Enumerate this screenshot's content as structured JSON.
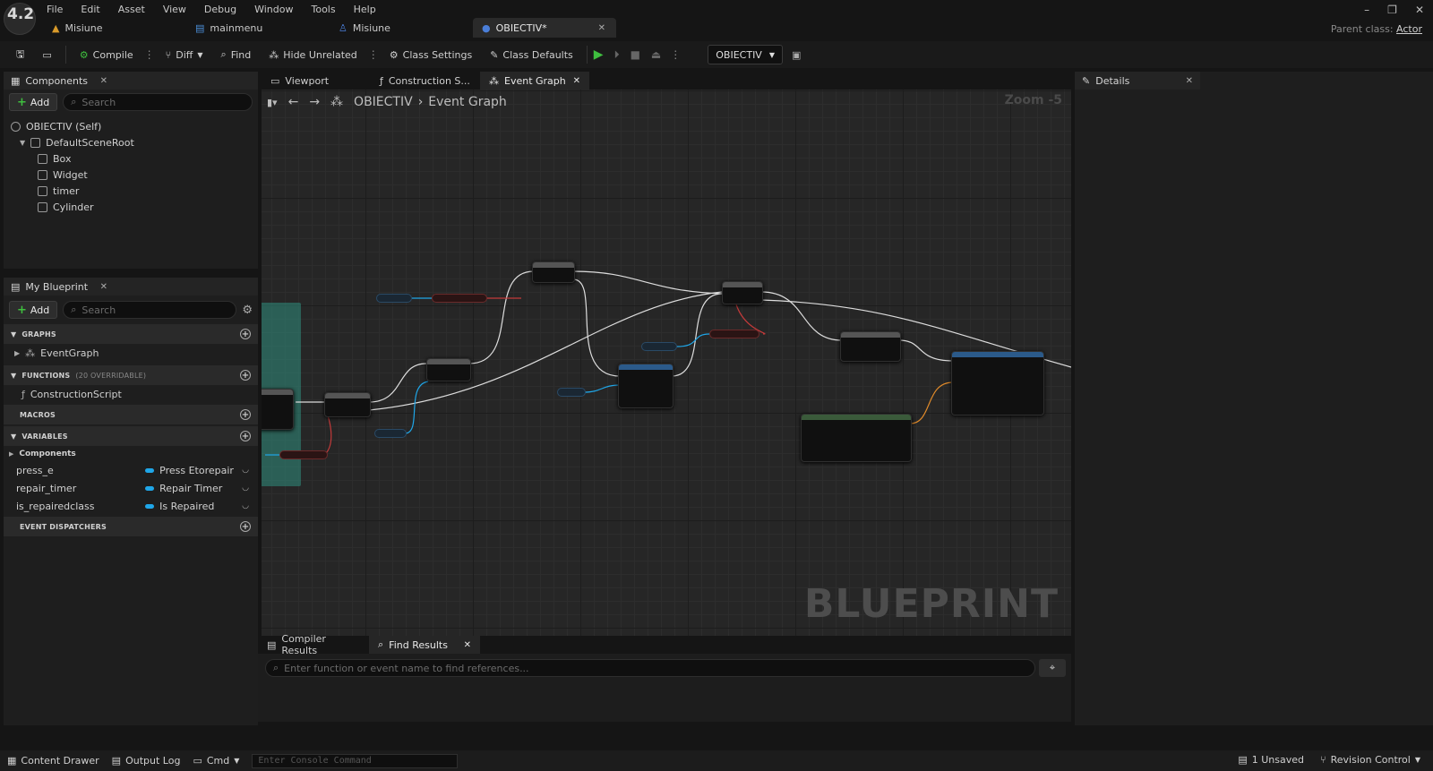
{
  "app": {
    "version": "4.2"
  },
  "menu": [
    "File",
    "Edit",
    "Asset",
    "View",
    "Debug",
    "Window",
    "Tools",
    "Help"
  ],
  "doc_tabs": [
    {
      "label": "Misiune",
      "icon": "warning-icon"
    },
    {
      "label": "mainmenu",
      "icon": "widget-icon"
    },
    {
      "label": "Misiune",
      "icon": "blueprint-icon"
    },
    {
      "label": "OBIECTIV*",
      "icon": "blueprint-active-icon",
      "active": true
    }
  ],
  "window_controls": [
    "–",
    "❐",
    "✕"
  ],
  "parent_class": {
    "label": "Parent class:",
    "value": "Actor"
  },
  "toolbar": {
    "compile": "Compile",
    "diff": "Diff",
    "find": "Find",
    "hide_unrelated": "Hide Unrelated",
    "class_settings": "Class Settings",
    "class_defaults": "Class Defaults",
    "debug_object": "OBIECTIV"
  },
  "components_panel": {
    "title": "Components",
    "add": "Add",
    "search_placeholder": "Search",
    "tree": [
      {
        "label": "OBIECTIV (Self)",
        "depth": 0
      },
      {
        "label": "DefaultSceneRoot",
        "depth": 1
      },
      {
        "label": "Box",
        "depth": 2
      },
      {
        "label": "Widget",
        "depth": 2
      },
      {
        "label": "timer",
        "depth": 2
      },
      {
        "label": "Cylinder",
        "depth": 2
      }
    ]
  },
  "my_blueprint": {
    "title": "My Blueprint",
    "add": "Add",
    "search_placeholder": "Search",
    "sections": {
      "graphs": "GRAPHS",
      "functions": "FUNCTIONS",
      "functions_sub": "(20 OVERRIDABLE)",
      "macros": "MACROS",
      "variables": "VARIABLES",
      "dispatchers": "EVENT DISPATCHERS"
    },
    "graph_items": [
      "EventGraph"
    ],
    "function_items": [
      "ConstructionScript"
    ],
    "variable_group": "Components",
    "variables": [
      {
        "name": "press_e",
        "type": "Press Etorepair"
      },
      {
        "name": "repair_timer",
        "type": "Repair Timer"
      },
      {
        "name": "is_repairedclass",
        "type": "Is Repaired"
      }
    ]
  },
  "graph_tabs": [
    {
      "label": "Viewport"
    },
    {
      "label": "Construction S..."
    },
    {
      "label": "Event Graph",
      "active": true
    }
  ],
  "graph": {
    "breadcrumb_root": "OBIECTIV",
    "breadcrumb_leaf": "Event Graph",
    "zoom": "Zoom -5",
    "watermark": "BLUEPRINT"
  },
  "bottom_tabs": [
    {
      "label": "Compiler Results"
    },
    {
      "label": "Find Results",
      "active": true
    }
  ],
  "find": {
    "placeholder": "Enter function or event name to find references..."
  },
  "details": {
    "title": "Details"
  },
  "statusbar": {
    "content_drawer": "Content Drawer",
    "output_log": "Output Log",
    "cmd": "Cmd",
    "console_placeholder": "Enter Console Command",
    "unsaved": "1 Unsaved",
    "revision_control": "Revision Control"
  }
}
